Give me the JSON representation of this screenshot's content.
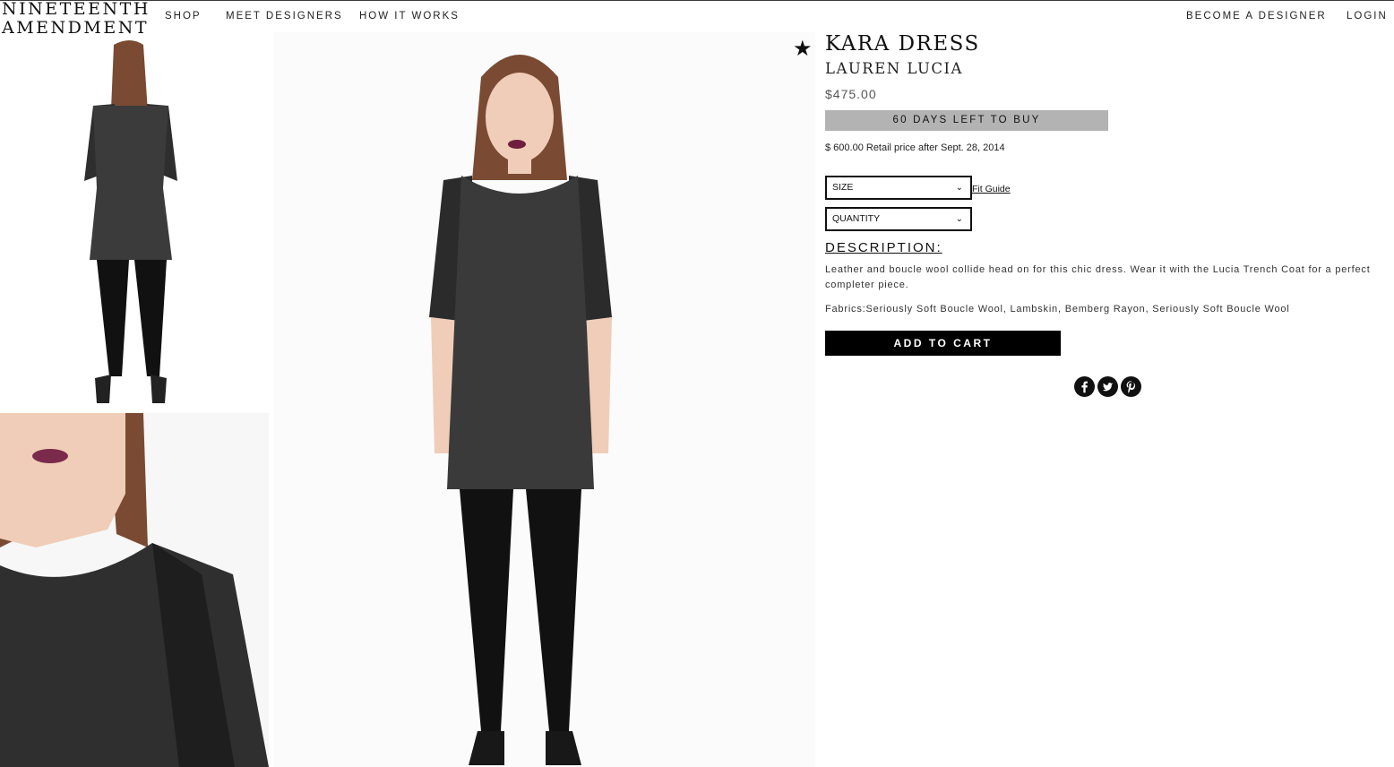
{
  "header": {
    "logo_line1": "NINETEENTH",
    "logo_line2": "AMENDMENT",
    "nav_left": [
      "SHOP",
      "MEET DESIGNERS",
      "HOW IT WORKS"
    ],
    "nav_right": [
      "BECOME A DESIGNER",
      "LOGIN"
    ]
  },
  "product": {
    "title": "KARA DRESS",
    "designer": "LAUREN LUCIA",
    "price": "$475.00",
    "days_left": "60 DAYS LEFT TO BUY",
    "retail_note": "$ 600.00 Retail price after Sept. 28, 2014",
    "size_label": "SIZE",
    "quantity_label": "QUANTITY",
    "fit_guide": "Fit Guide",
    "description_heading": "DESCRIPTION:",
    "description": "Leather and boucle wool collide head on for this chic dress. Wear it with the Lucia Trench Coat for a perfect completer piece.",
    "fabrics": "Fabrics:Seriously Soft Boucle Wool, Lambskin, Bemberg Rayon, Seriously Soft Boucle Wool",
    "add_to_cart": "ADD TO CART"
  },
  "icons": {
    "favorite": "star-icon",
    "social": [
      "facebook-icon",
      "twitter-icon",
      "pinterest-icon"
    ]
  },
  "colors": {
    "days_bar": "#b3b3b3",
    "cart_button": "#000000"
  }
}
